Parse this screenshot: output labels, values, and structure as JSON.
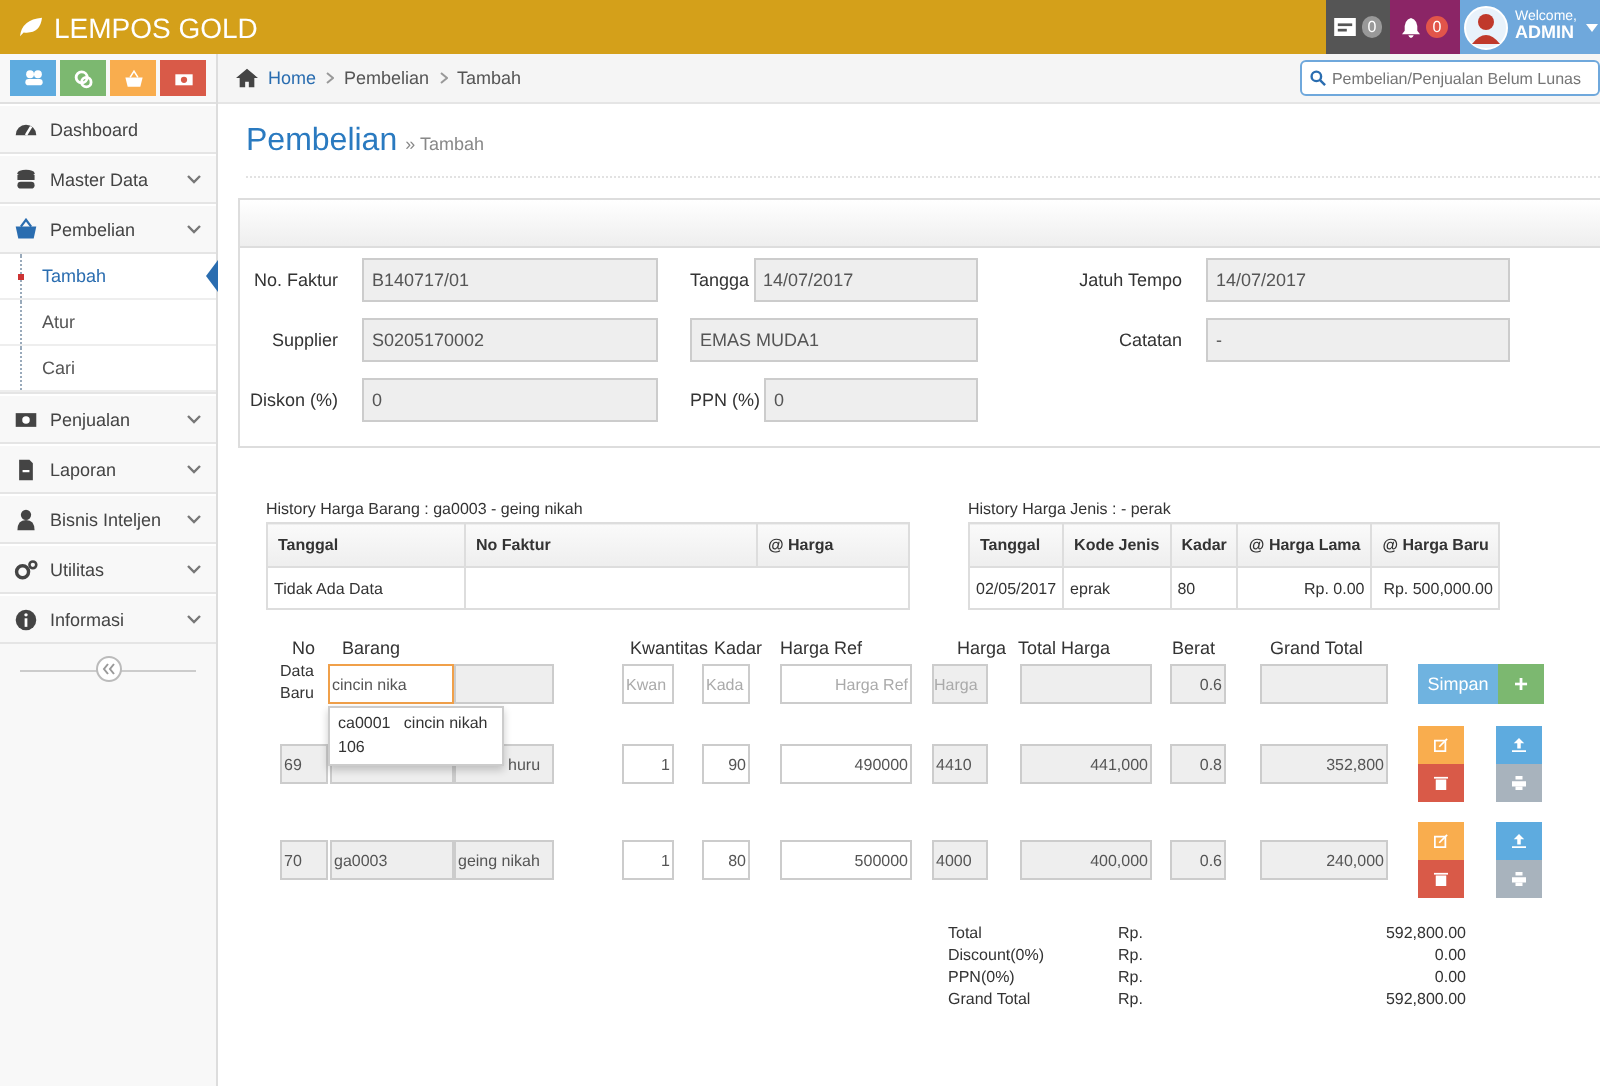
{
  "app": {
    "brand": "LEMPOS GOLD"
  },
  "topbar": {
    "messages_count": "0",
    "notifications_count": "0",
    "welcome": "Welcome,",
    "user": "ADMIN"
  },
  "shortcuts": [
    {
      "color": "#5eabdf"
    },
    {
      "color": "#7cb870"
    },
    {
      "color": "#f9ad4e"
    },
    {
      "color": "#d95a48"
    }
  ],
  "sidebar": {
    "items": [
      {
        "label": "Dashboard",
        "has_submenu": false
      },
      {
        "label": "Master Data",
        "has_submenu": true
      },
      {
        "label": "Pembelian",
        "has_submenu": true,
        "children": [
          {
            "label": "Tambah",
            "selected": true
          },
          {
            "label": "Atur",
            "selected": false
          },
          {
            "label": "Cari",
            "selected": false
          }
        ]
      },
      {
        "label": "Penjualan",
        "has_submenu": true
      },
      {
        "label": "Laporan",
        "has_submenu": true
      },
      {
        "label": "Bisnis Inteljen",
        "has_submenu": true
      },
      {
        "label": "Utilitas",
        "has_submenu": true
      },
      {
        "label": "Informasi",
        "has_submenu": true
      }
    ]
  },
  "breadcrumb": [
    "Home",
    "Pembelian",
    "Tambah"
  ],
  "search": {
    "placeholder": "Pembelian/Penjualan Belum Lunas"
  },
  "page": {
    "title": "Pembelian",
    "subtitle": "» Tambah"
  },
  "form": {
    "rows": [
      [
        {
          "label": "No. Faktur",
          "value": "B140717/01"
        },
        {
          "label": "Tangga",
          "value": "14/07/2017"
        },
        {
          "label": "Jatuh Tempo",
          "value": "14/07/2017"
        }
      ],
      [
        {
          "label": "Supplier",
          "value": "S0205170002"
        },
        {
          "value": "EMAS MUDA1"
        },
        {
          "label": "Catatan",
          "value": "-"
        }
      ],
      [
        {
          "label": "Diskon (%)",
          "value": "0"
        },
        {
          "label": "PPN (%)",
          "value": "0"
        }
      ]
    ]
  },
  "history": [
    {
      "title": "History Harga Barang : ga0003 - geing nikah",
      "columns": [
        "Tanggal",
        "No Faktur",
        "@ Harga"
      ],
      "rows": [
        [
          "Tidak Ada Data"
        ]
      ]
    },
    {
      "title": "History Harga Jenis : - perak",
      "columns": [
        "Tanggal",
        "Kode Jenis",
        "Kadar",
        "@ Harga Lama",
        "@ Harga Baru"
      ],
      "rows": [
        [
          "02/05/2017",
          "eprak",
          "80",
          "Rp. 0.00",
          "Rp. 500,000.00"
        ]
      ]
    }
  ],
  "items": {
    "columns": [
      "No",
      "Barang",
      "Kwantitas",
      "Kadar",
      "Harga Ref",
      "Harga",
      "Total Harga",
      "Berat",
      "Grand Total"
    ],
    "new_entry": {
      "label": "Data Baru",
      "barang": "cincin nika",
      "kwantitas_placeholder": "Kwan",
      "kadar_placeholder": "Kada",
      "harga_ref_placeholder": "Harga Ref",
      "harga_placeholder": "Harga",
      "berat": "0.6",
      "save_button": "Simpan",
      "add_button": "+",
      "suggestions": [
        {
          "code": "ca0001",
          "name": "cincin nikah",
          "line_2": "106"
        }
      ]
    },
    "rows": [
      {
        "no": "69",
        "name": "huru",
        "qty": "1",
        "kadar": "90",
        "harga_ref": "490000",
        "harga": "4410",
        "total_harga": "441,000",
        "berat": "0.8",
        "grand_total": "352,800"
      },
      {
        "no": "70",
        "code": "ga0003",
        "name": "geing nikah",
        "qty": "1",
        "kadar": "80",
        "harga_ref": "500000",
        "harga": "4000",
        "total_harga": "400,000",
        "berat": "0.6",
        "grand_total": "240,000"
      }
    ]
  },
  "totals": [
    {
      "label": "Total",
      "currency": "Rp.",
      "value": "592,800.00"
    },
    {
      "label": "Discount(0%)",
      "currency": "Rp.",
      "value": "0.00"
    },
    {
      "label": "PPN(0%)",
      "currency": "Rp.",
      "value": "0.00"
    },
    {
      "label": "Grand Total",
      "currency": "Rp.",
      "value": "592,800.00"
    }
  ]
}
